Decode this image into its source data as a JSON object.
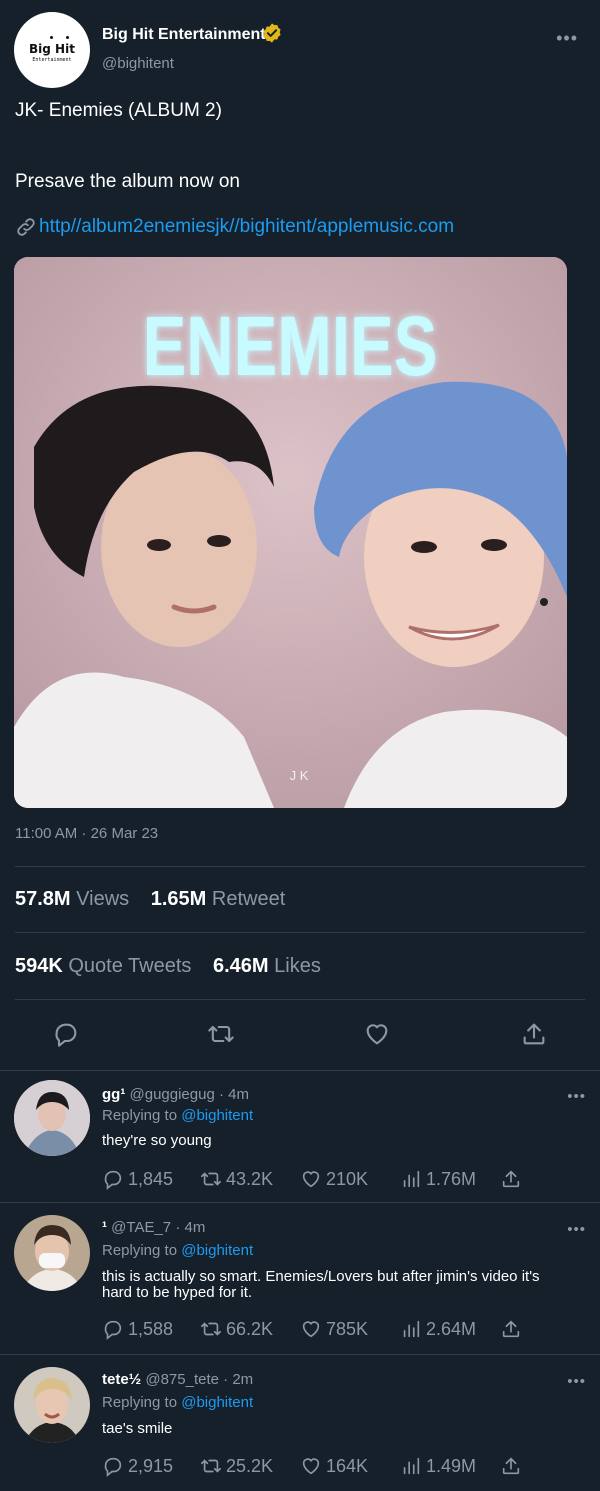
{
  "tweet": {
    "author_name": "Big Hit Entertainment",
    "author_handle": "@bighitent",
    "avatar_logo": "Big Hit",
    "avatar_logo_sub": "Entertainment",
    "title_line": "JK- Enemies (ALBUM 2)",
    "presave_line": "Presave the album now on",
    "link_text": "http//album2enemiesjk//bighitent/applemusic.com",
    "media_title": "ENEMIES",
    "media_caption": "J K",
    "timestamp": "11:00 AM · 26 Mar 23",
    "verified_color": "#e2b719",
    "link_color": "#1d9bf0"
  },
  "stats": {
    "views_num": "57.8M",
    "views_label": "Views",
    "retweet_num": "1.65M",
    "retweet_label": "Retweet",
    "quote_num": "594K",
    "quote_label": "Quote Tweets",
    "likes_num": "6.46M",
    "likes_label": "Likes"
  },
  "actions": [
    "reply-icon",
    "retweet-icon",
    "like-icon",
    "share-icon"
  ],
  "replies": [
    {
      "name": "gg¹",
      "handle": "@guggiegug",
      "time": "· 4m",
      "replying_label": "Replying to",
      "replying_to": "@bighitent",
      "text": "they're so young",
      "replies": "1,845",
      "retweets": "43.2K",
      "likes": "210K",
      "views": "1.76M"
    },
    {
      "name": "¹",
      "handle": "@TAE_7",
      "time": "· 4m",
      "replying_label": "Replying to",
      "replying_to": "@bighitent",
      "text": "this is actually so smart. Enemies/Lovers but after jimin's video it's hard to be hyped for it.",
      "replies": "1,588",
      "retweets": "66.2K",
      "likes": "785K",
      "views": "2.64M"
    },
    {
      "name": "tete½",
      "handle": "@875_tete",
      "time": "· 2m",
      "replying_label": "Replying to",
      "replying_to": "@bighitent",
      "text": "tae's smile",
      "replies": "2,915",
      "retweets": "25.2K",
      "likes": "164K",
      "views": "1.49M"
    }
  ]
}
